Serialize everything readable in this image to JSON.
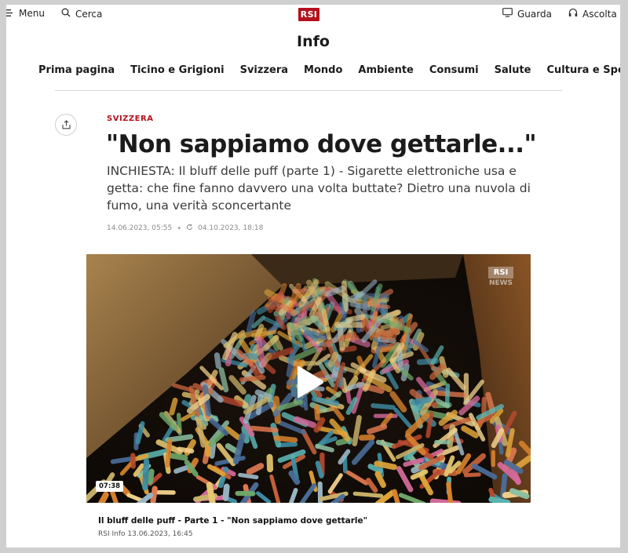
{
  "topbar": {
    "menu_label": "Menu",
    "search_label": "Cerca",
    "logo": "RSI",
    "watch_label": "Guarda",
    "listen_label": "Ascolta"
  },
  "section_title": "Info",
  "nav": {
    "items": [
      "Prima pagina",
      "Ticino e Grigioni",
      "Svizzera",
      "Mondo",
      "Ambiente",
      "Consumi",
      "Salute",
      "Cultura e Spettacoli"
    ]
  },
  "article": {
    "kicker": "SVIZZERA",
    "headline": "\"Non sappiamo dove gettarle...\"",
    "lead": "INCHIESTA: Il bluff delle puff (parte 1) - Sigarette elettroniche usa e getta: che fine fanno davvero una volta buttate? Dietro una nuvola di fumo, una verità sconcertante",
    "published": "14.06.2023, 05:55",
    "separator": "•",
    "updated": "04.10.2023, 18:18"
  },
  "video": {
    "brand_top": "RSI",
    "brand_bottom": "NEWS",
    "duration": "07:38",
    "title": "Il bluff delle puff - Parte 1 - \"Non sappiamo dove gettarle\"",
    "subtitle": "RSI Info 13.06.2023, 16:45"
  },
  "colors": {
    "accent": "#b4111c",
    "text": "#1b1b1b",
    "meta": "#8a8a8a"
  },
  "icons": [
    "menu-icon",
    "search-icon",
    "tv-icon",
    "headphones-icon",
    "share-icon",
    "update-icon",
    "play-icon"
  ]
}
